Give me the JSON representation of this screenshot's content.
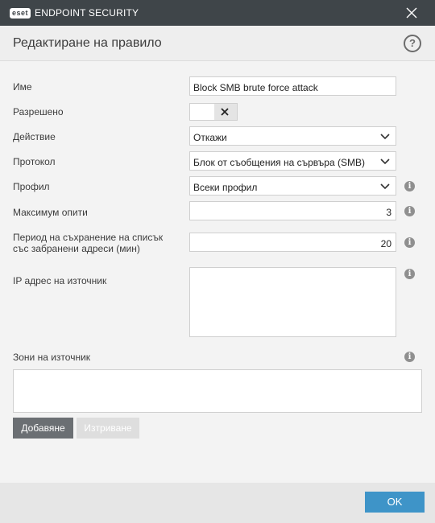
{
  "titlebar": {
    "logo_badge": "eset",
    "app_name": "ENDPOINT SECURITY"
  },
  "header": {
    "title": "Редактиране на правило",
    "help": "?"
  },
  "form": {
    "name": {
      "label": "Име",
      "value": "Block SMB brute force attack"
    },
    "enabled": {
      "label": "Разрешено",
      "state": "off"
    },
    "action": {
      "label": "Действие",
      "value": "Откажи"
    },
    "protocol": {
      "label": "Протокол",
      "value": "Блок от съобщения на сървъра (SMB)"
    },
    "profile": {
      "label": "Профил",
      "value": "Всеки профил"
    },
    "max_attempts": {
      "label": "Максимум опити",
      "value": "3"
    },
    "retention": {
      "label_line1": "Период на съхранение на списък",
      "label_line2": "със забранени адреси (мин)",
      "value": "20"
    },
    "source_ip": {
      "label": "IP адрес на източник",
      "value": ""
    },
    "source_zones": {
      "label": "Зони на източник"
    }
  },
  "buttons": {
    "add": "Добавяне",
    "delete": "Изтриване",
    "ok": "OK"
  },
  "icons": {
    "info": "i"
  },
  "colors": {
    "titlebar": "#3f4549",
    "ok_button": "#3e94c8",
    "add_button": "#6b6f73"
  }
}
